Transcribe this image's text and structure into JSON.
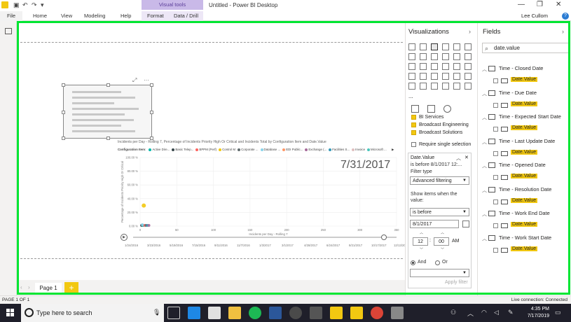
{
  "titlebar": {
    "title": "Untitled - Power BI Desktop",
    "contextual_tab": "Visual tools",
    "undo_icon": "undo-icon",
    "minimize": "—",
    "restore": "❐",
    "close": "✕"
  },
  "ribbon": {
    "file": "File",
    "tabs": [
      "Home",
      "View",
      "Modeling",
      "Help",
      "Format",
      "Data / Drill"
    ],
    "user": "Lee Cullom",
    "help": "?"
  },
  "canvas": {
    "chart_title": "Incidents per Day - Rolling 7, Percentage of Incidents Priority High Or Critical and Incidents Total by Configuration Item and Date.Value",
    "legend_label": "Configuration Item",
    "legend_items": [
      {
        "name": "Active Dire...",
        "color": "#01b8aa"
      },
      {
        "name": "Basic Telep...",
        "color": "#374649"
      },
      {
        "name": "BPPM (Perf)",
        "color": "#fd625e"
      },
      {
        "name": "Control M",
        "color": "#f2c80f"
      },
      {
        "name": "Corporate ...",
        "color": "#5f6b6d"
      },
      {
        "name": "Database ...",
        "color": "#8ad4eb"
      },
      {
        "name": "EDI Public...",
        "color": "#fe9666"
      },
      {
        "name": "Exchange (...",
        "color": "#a66999"
      },
      {
        "name": "Facilities S...",
        "color": "#3599b8"
      },
      {
        "name": "Invoice",
        "color": "#dfbfbf"
      },
      {
        "name": "Microsoft ...",
        "color": "#4ac5bb"
      }
    ],
    "big_date": "7/31/2017",
    "play_axis_ticks": [
      "1/24/2016",
      "3/23/2016",
      "5/19/2016",
      "7/15/2016",
      "9/11/2016",
      "11/7/2016",
      "1/3/2017",
      "3/1/2017",
      "4/28/2017",
      "6/24/2017",
      "8/21/2017",
      "10/17/2017",
      "12/13/2017"
    ]
  },
  "chart_data": {
    "type": "scatter",
    "title": "Incidents per Day - Rolling 7, Percentage of Incidents Priority High Or Critical and Incidents Total by Configuration Item and Date.Value",
    "xlabel": "Incidents per Day - Rolling 7",
    "ylabel": "Percentage of Incidents Priority High Or Critical",
    "x_ticks": [
      "0",
      "50",
      "100",
      "150",
      "200",
      "250",
      "300",
      "350"
    ],
    "y_ticks": [
      "0.00 %",
      "20.00 %",
      "40.00 %",
      "60.00 %",
      "80.00 %",
      "100.00 %"
    ],
    "xlim": [
      0,
      350
    ],
    "ylim": [
      0,
      100
    ],
    "points": [
      {
        "x": 5,
        "y": 30,
        "color": "#f2c80f"
      },
      {
        "x": 2,
        "y": 1,
        "color": "#374649"
      },
      {
        "x": 4,
        "y": 1,
        "color": "#01b8aa"
      },
      {
        "x": 6,
        "y": 1,
        "color": "#fd625e"
      },
      {
        "x": 8,
        "y": 1,
        "color": "#5f6b6d"
      },
      {
        "x": 10,
        "y": 1,
        "color": "#3599b8"
      },
      {
        "x": 12,
        "y": 1,
        "color": "#a66999"
      },
      {
        "x": 3,
        "y": 2,
        "color": "#8ad4eb"
      }
    ],
    "grid": true
  },
  "pages": {
    "page_label": "Page 1",
    "add": "+"
  },
  "visualizations": {
    "title": "Visualizations",
    "more": "...",
    "filter_items": [
      {
        "label": "BI Services",
        "checked": true
      },
      {
        "label": "Broadcast Engineering",
        "checked": true
      },
      {
        "label": "Broadcast Solutions",
        "checked": true
      }
    ],
    "single_select": "Require single selection",
    "card": {
      "field": "Date.Value",
      "summary": "is before 8/1/2017 12:...",
      "filter_type_label": "Filter type",
      "filter_type_value": "Advanced filtering",
      "show_items": "Show items when the value:",
      "condition": "is before",
      "date": "8/1/2017",
      "hour": "12",
      "minute": "00",
      "ampm": "AM",
      "and": "And",
      "or": "Or",
      "apply": "Apply filter"
    }
  },
  "fields": {
    "title": "Fields",
    "search_value": "date.value",
    "tables": [
      {
        "name": "Time - Closed Date",
        "field": "Date.Value"
      },
      {
        "name": "Time - Due Date",
        "field": "Date.Value"
      },
      {
        "name": "Time - Expected Start Date",
        "field": "Date.Value"
      },
      {
        "name": "Time - Last Update Date",
        "field": "Date.Value"
      },
      {
        "name": "Time - Opened Date",
        "field": "Date.Value"
      },
      {
        "name": "Time - Resolution Date",
        "field": "Date.Value"
      },
      {
        "name": "Time - Work End Date",
        "field": "Date.Value"
      },
      {
        "name": "Time - Work Start Date",
        "field": "Date.Value"
      }
    ]
  },
  "status": {
    "page": "PAGE 1 OF 1",
    "connection": "Live connection: Connected"
  },
  "taskbar": {
    "search_placeholder": "Type here to search",
    "time": "4:35 PM",
    "date": "7/17/2019"
  }
}
